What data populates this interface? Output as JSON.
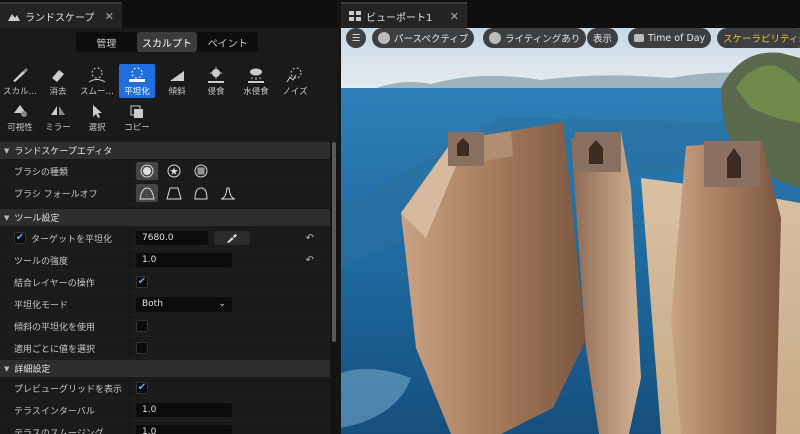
{
  "left_tab": {
    "title": "ランドスケープ"
  },
  "modes": [
    "管理",
    "スカルプト",
    "ペイント"
  ],
  "tools": [
    {
      "label": "スカル…",
      "icon": "sculpt-icon"
    },
    {
      "label": "消去",
      "icon": "erase-icon"
    },
    {
      "label": "スムー…",
      "icon": "smooth-icon"
    },
    {
      "label": "平坦化",
      "icon": "flatten-icon",
      "active": true
    },
    {
      "label": "傾斜",
      "icon": "ramp-icon"
    },
    {
      "label": "侵食",
      "icon": "erosion-icon"
    },
    {
      "label": "水侵食",
      "icon": "hydro-erosion-icon"
    },
    {
      "label": "ノイズ",
      "icon": "noise-icon"
    },
    {
      "label": "可視性",
      "icon": "visibility-icon"
    },
    {
      "label": "ミラー",
      "icon": "mirror-icon"
    },
    {
      "label": "選択",
      "icon": "select-icon"
    },
    {
      "label": "コピー",
      "icon": "copy-icon"
    }
  ],
  "sections": {
    "editor": "ランドスケープエディタ",
    "tool_settings": "ツール設定",
    "advanced": "詳細設定"
  },
  "rows": {
    "brush_type": "ブラシの種類",
    "brush_falloff": "ブラシ フォールオフ",
    "flatten_target": "ターゲットを平坦化",
    "flatten_target_value": "7680.0",
    "tool_strength": "ツールの強度",
    "tool_strength_value": "1.0",
    "combined_layer": "結合レイヤーの操作",
    "flatten_mode": "平坦化モード",
    "flatten_mode_value": "Both",
    "use_slope": "傾斜の平坦化を使用",
    "pick_value": "適用ごとに値を選択",
    "preview_grid": "プレビューグリッドを表示",
    "terrace_interval": "テラスインターバル",
    "terrace_interval_value": "1.0",
    "terrace_smoothing": "テラスのスムージング",
    "terrace_smoothing_value": "1.0"
  },
  "viewport": {
    "tab_title": "ビューポート1",
    "perspective": "パースペクティブ",
    "lighting": "ライティングあり",
    "show": "表示",
    "time_of_day": "Time of Day",
    "scalability": "スケーラビリティ:"
  }
}
